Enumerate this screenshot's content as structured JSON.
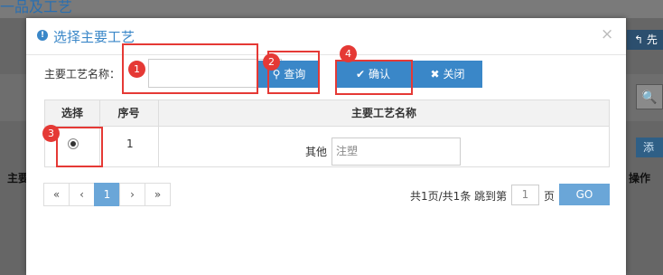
{
  "background": {
    "title_fragment": "一品及工艺",
    "right_button": "先",
    "add_button": "添",
    "left_column": "主要",
    "right_column": "操作"
  },
  "modal": {
    "title": "选择主要工艺",
    "close_symbol": "×",
    "field_label": "主要工艺名称：",
    "name_input_value": "",
    "buttons": {
      "query": "查询",
      "confirm": "确认",
      "close": "关闭"
    },
    "table": {
      "headers": [
        "选择",
        "序号",
        "主要工艺名称"
      ],
      "rows": [
        {
          "selected": true,
          "index": "1",
          "name_label": "其他",
          "name_placeholder": "注塑"
        }
      ]
    },
    "pagination": {
      "buttons": [
        "«",
        "‹",
        "1",
        "›",
        "»"
      ],
      "current_page": "1",
      "info": "共1页/共1条 跳到第",
      "page_input": "1",
      "page_suffix": "页",
      "go_label": "GO"
    }
  },
  "annotations": [
    "1",
    "2",
    "3",
    "4"
  ],
  "colors": {
    "accent": "#3a87c8",
    "annotation": "#e53935",
    "pager_active": "#6aa6d8"
  }
}
